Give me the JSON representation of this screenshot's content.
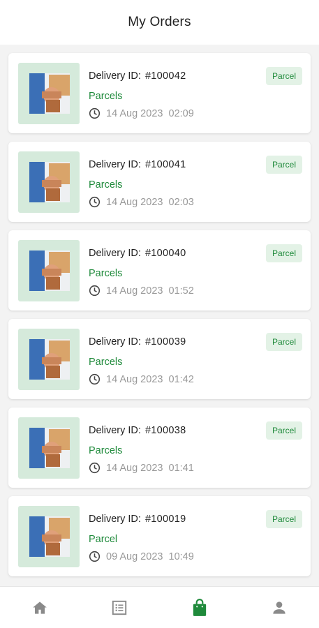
{
  "header": {
    "title": "My Orders"
  },
  "colors": {
    "accent": "#1f8a3b",
    "badge_bg": "#e3f2e6",
    "thumb_bg": "#d5eadb",
    "muted": "#999999"
  },
  "orders": [
    {
      "id_label": "Delivery ID:",
      "id": "#100042",
      "category": "Parcels",
      "date": "14 Aug 2023",
      "time": "02:09",
      "badge": "Parcel"
    },
    {
      "id_label": "Delivery ID:",
      "id": "#100041",
      "category": "Parcels",
      "date": "14 Aug 2023",
      "time": "02:03",
      "badge": "Parcel"
    },
    {
      "id_label": "Delivery ID:",
      "id": "#100040",
      "category": "Parcels",
      "date": "14 Aug 2023",
      "time": "01:52",
      "badge": "Parcel"
    },
    {
      "id_label": "Delivery ID:",
      "id": "#100039",
      "category": "Parcels",
      "date": "14 Aug 2023",
      "time": "01:42",
      "badge": "Parcel"
    },
    {
      "id_label": "Delivery ID:",
      "id": "#100038",
      "category": "Parcels",
      "date": "14 Aug 2023",
      "time": "01:41",
      "badge": "Parcel"
    },
    {
      "id_label": "Delivery ID:",
      "id": "#100019",
      "category": "Parcel",
      "date": "09 Aug 2023",
      "time": "10:49",
      "badge": "Parcel"
    }
  ],
  "nav": [
    {
      "icon": "home-icon",
      "active": false
    },
    {
      "icon": "list-icon",
      "active": false
    },
    {
      "icon": "shopping-bag-icon",
      "active": true
    },
    {
      "icon": "person-icon",
      "active": false
    }
  ]
}
